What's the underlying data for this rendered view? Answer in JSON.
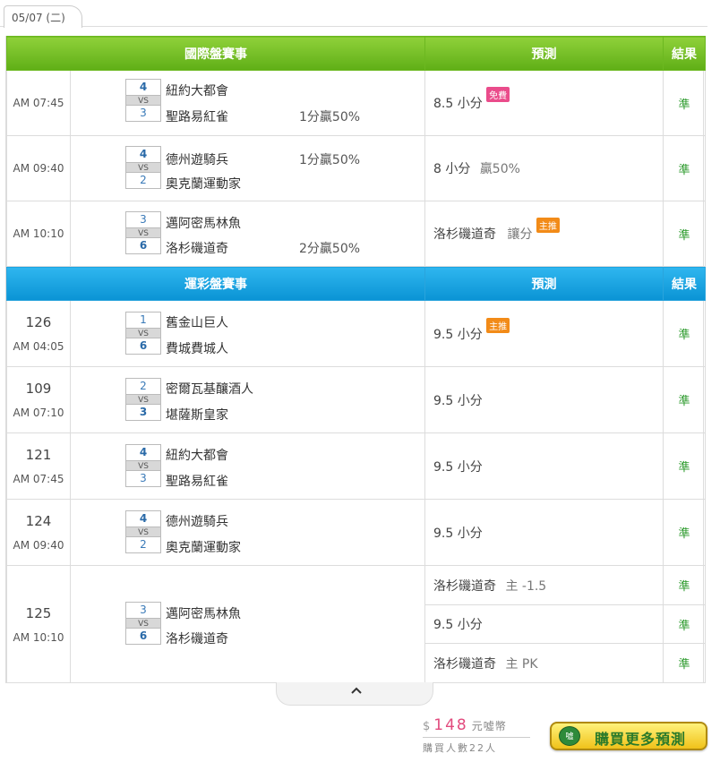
{
  "date_tab": "05/07 (二)",
  "section1": {
    "title": "國際盤賽事",
    "pred_header": "預測",
    "result_header": "結果",
    "rows": [
      {
        "time": "AM 07:45",
        "s1": "4",
        "vs": "VS",
        "s2": "3",
        "team1": "紐約大都會",
        "team2": "聖路易紅雀",
        "handicap": "1分贏50%",
        "pred_main": "8.5 小分",
        "pred_sub": "",
        "badge": "免費",
        "result": "準"
      },
      {
        "time": "AM 09:40",
        "s1": "4",
        "vs": "VS",
        "s2": "2",
        "team1": "德州遊騎兵",
        "team2": "奧克蘭運動家",
        "handicap": "1分贏50%",
        "pred_main": "8 小分",
        "pred_sub": "贏50%",
        "badge": "",
        "result": "準"
      },
      {
        "time": "AM 10:10",
        "s1": "3",
        "vs": "VS",
        "s2": "6",
        "team1": "邁阿密馬林魚",
        "team2": "洛杉磯道奇",
        "handicap": "2分贏50%",
        "pred_main": "洛杉磯道奇",
        "pred_sub": "讓分",
        "badge": "主推",
        "result": "準"
      }
    ]
  },
  "section2": {
    "title": "運彩盤賽事",
    "pred_header": "預測",
    "result_header": "結果",
    "rows": [
      {
        "num": "126",
        "time": "AM 04:05",
        "s1": "1",
        "vs": "VS",
        "s2": "6",
        "team1": "舊金山巨人",
        "team2": "費城費城人",
        "pred_main": "9.5 小分",
        "badge": "主推",
        "result": "準"
      },
      {
        "num": "109",
        "time": "AM 07:10",
        "s1": "2",
        "vs": "VS",
        "s2": "3",
        "team1": "密爾瓦基釀酒人",
        "team2": "堪薩斯皇家",
        "pred_main": "9.5 小分",
        "badge": "",
        "result": "準"
      },
      {
        "num": "121",
        "time": "AM 07:45",
        "s1": "4",
        "vs": "VS",
        "s2": "3",
        "team1": "紐約大都會",
        "team2": "聖路易紅雀",
        "pred_main": "9.5 小分",
        "badge": "",
        "result": "準"
      },
      {
        "num": "124",
        "time": "AM 09:40",
        "s1": "4",
        "vs": "VS",
        "s2": "2",
        "team1": "德州遊騎兵",
        "team2": "奧克蘭運動家",
        "pred_main": "9.5 小分",
        "badge": "",
        "result": "準"
      },
      {
        "num": "125",
        "time": "AM 10:10",
        "s1": "3",
        "vs": "VS",
        "s2": "6",
        "team1": "邁阿密馬林魚",
        "team2": "洛杉磯道奇",
        "preds": [
          {
            "main": "洛杉磯道奇",
            "sub": "主 -1.5",
            "result": "準"
          },
          {
            "main": "9.5 小分",
            "sub": "",
            "result": "準"
          },
          {
            "main": "洛杉磯道奇",
            "sub": "主 PK",
            "result": "準"
          }
        ]
      }
    ]
  },
  "footer": {
    "currency": "$",
    "amount": "148",
    "unit": "元噓幣",
    "buyers": "購買人數22人",
    "buy_button": "購買更多預測",
    "logo_text": "噓"
  },
  "colors": {
    "green_header": "#6cb820",
    "blue_header": "#0a93d4",
    "result_green": "#2c9a2c",
    "badge_free": "#ea4c8b",
    "badge_main": "#f28b18"
  },
  "icons": {
    "collapse": "chevron-up-icon"
  }
}
